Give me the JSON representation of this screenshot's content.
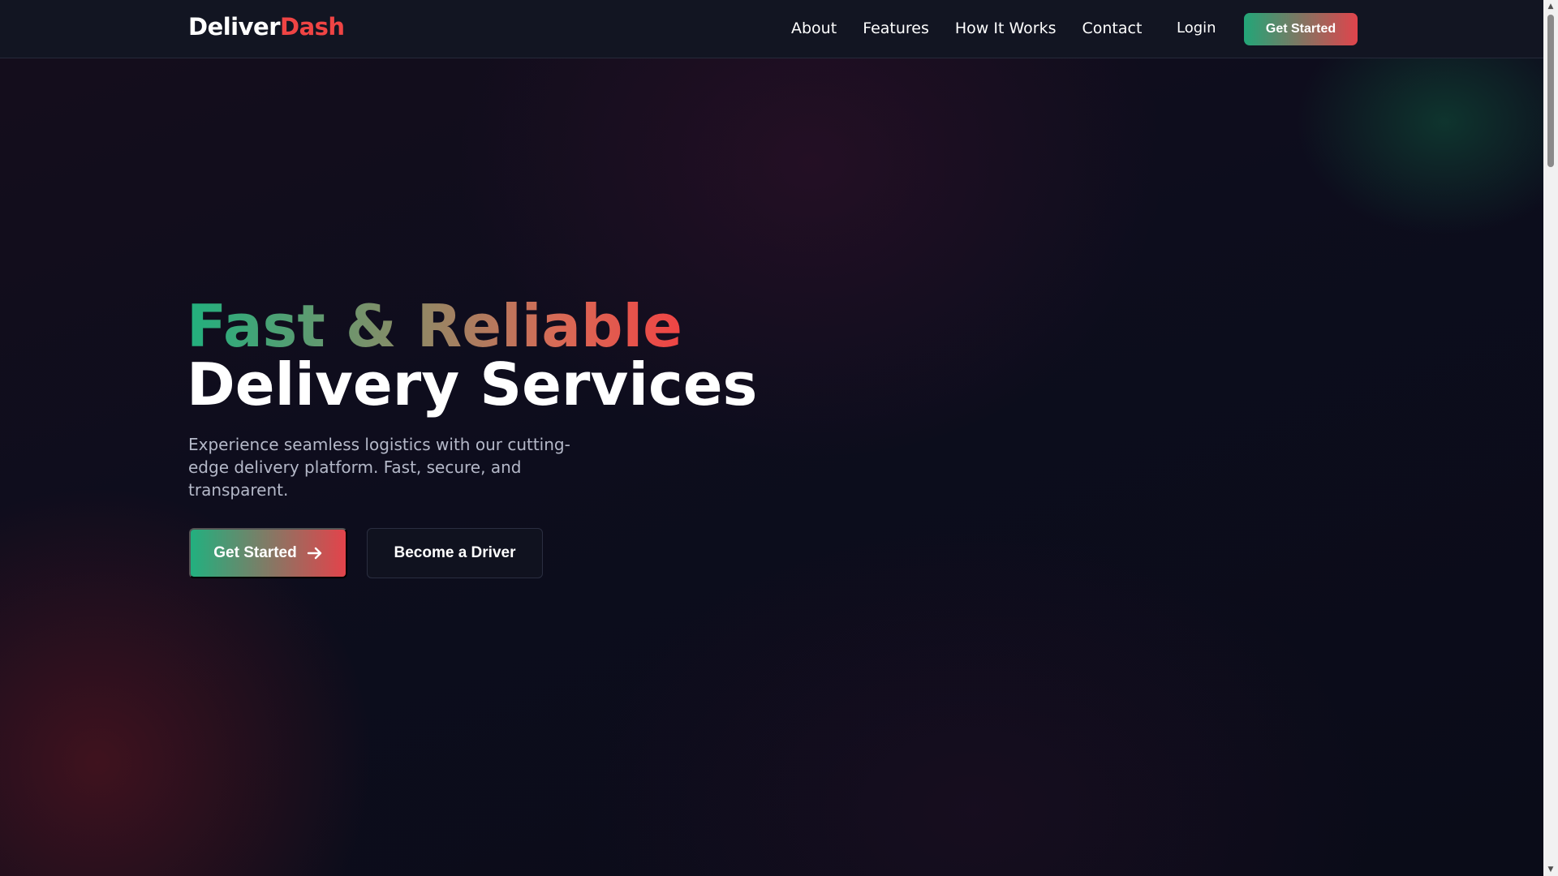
{
  "brand": {
    "part1": "Deliver",
    "part2": "Dash"
  },
  "nav": {
    "links": [
      "About",
      "Features",
      "How It Works",
      "Contact"
    ],
    "login": "Login",
    "cta": "Get Started"
  },
  "hero": {
    "title_line1": "Fast & Reliable",
    "title_line2": "Delivery Services",
    "subtitle": "Experience seamless logistics with our cutting-edge delivery platform. Fast, secure, and transparent.",
    "primary_button": "Get Started",
    "secondary_button": "Become a Driver"
  },
  "colors": {
    "accent_green": "#22b07f",
    "accent_red": "#ef4444",
    "background": "#0a0c18"
  },
  "icons": {
    "primary_button_icon": "arrow-right-icon",
    "scroll_up": "arrow-up-icon",
    "scroll_down": "arrow-down-icon"
  }
}
